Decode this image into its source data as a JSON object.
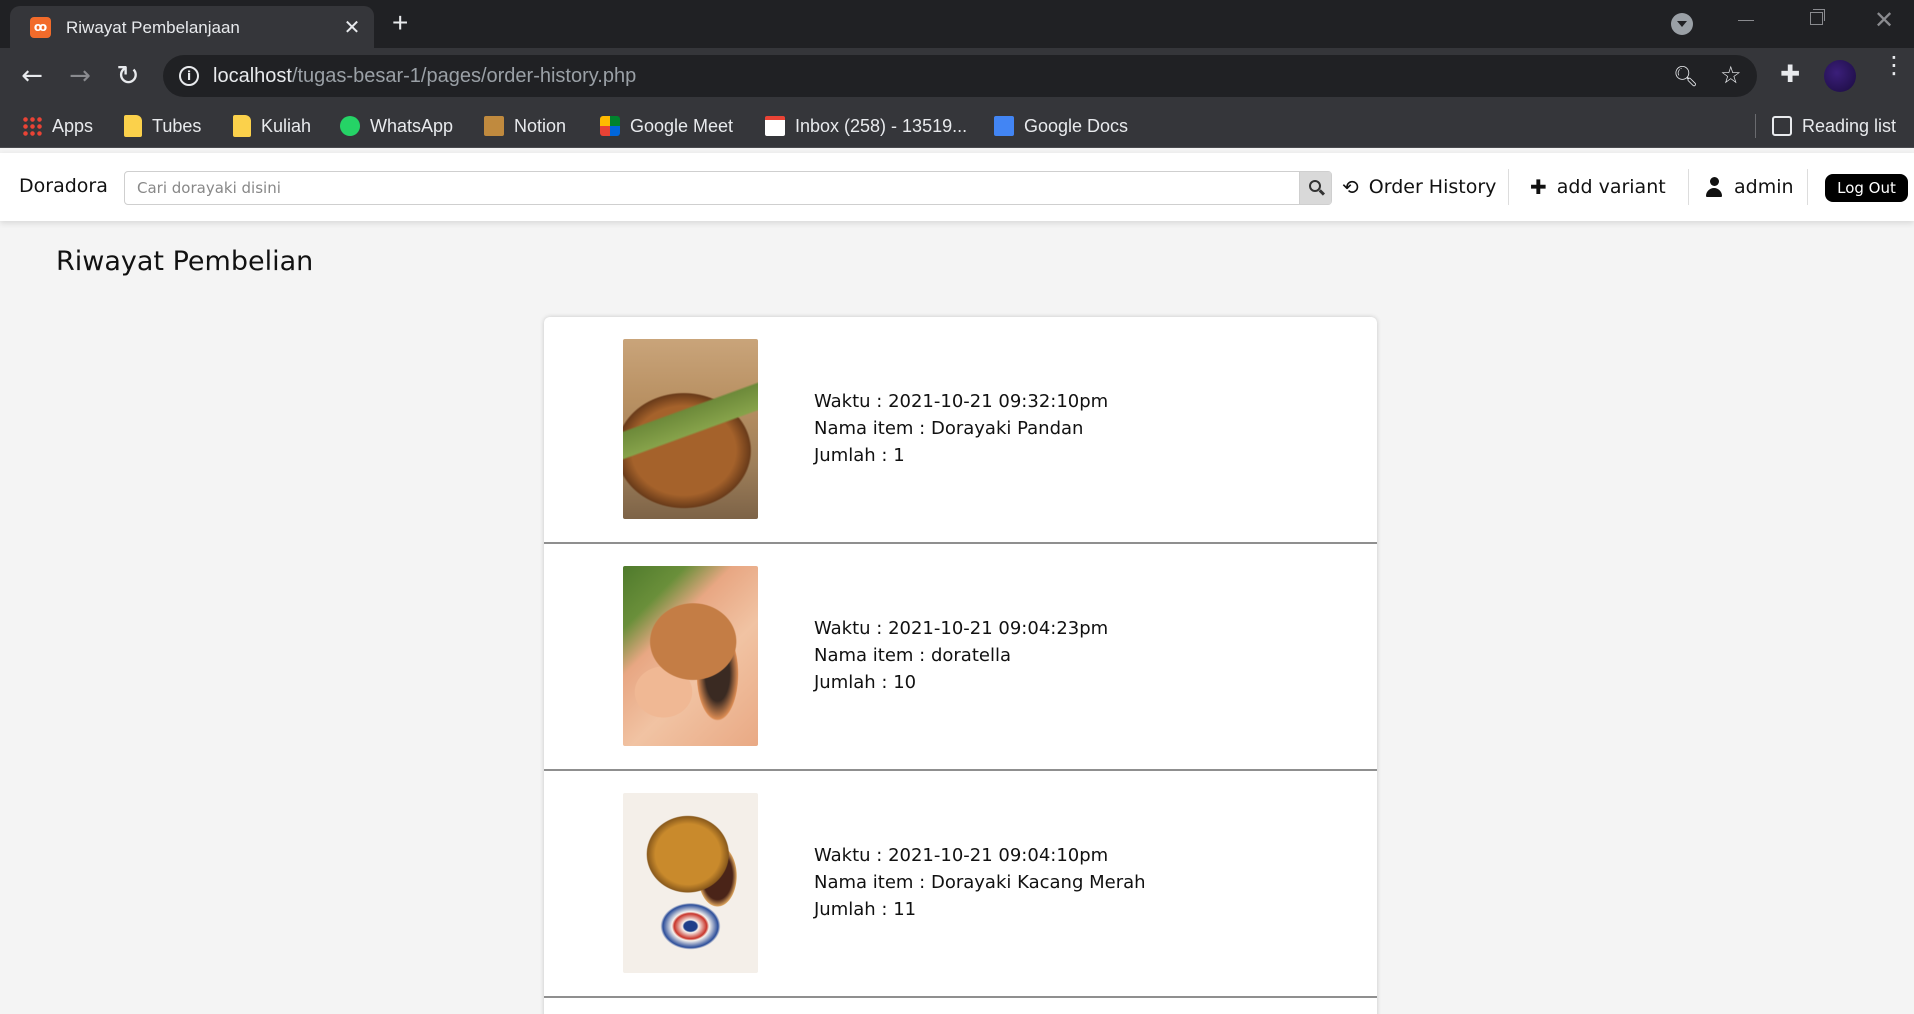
{
  "browser": {
    "tab_title": "Riwayat Pembelanjaan",
    "url_host": "localhost",
    "url_path": "/tugas-besar-1/pages/order-history.php",
    "bookmarks": [
      {
        "label": "Apps",
        "icon": "apps-grid-icon"
      },
      {
        "label": "Tubes",
        "icon": "folder-icon"
      },
      {
        "label": "Kuliah",
        "icon": "folder-icon"
      },
      {
        "label": "WhatsApp",
        "icon": "whatsapp-icon"
      },
      {
        "label": "Notion",
        "icon": "notion-icon"
      },
      {
        "label": "Google Meet",
        "icon": "google-meet-icon"
      },
      {
        "label": "Inbox (258) - 13519...",
        "icon": "gmail-icon"
      },
      {
        "label": "Google Docs",
        "icon": "google-docs-icon"
      }
    ],
    "reading_list": "Reading list"
  },
  "navbar": {
    "brand": "Doradora",
    "search_placeholder": "Cari dorayaki disini",
    "order_history": "Order History",
    "add_variant": "add variant",
    "user": "admin",
    "logout": "Log Out"
  },
  "page": {
    "title": "Riwayat Pembelian",
    "orders": [
      {
        "waktu": "Waktu : 2021-10-21 09:32:10pm",
        "nama": "Nama item : Dorayaki Pandan",
        "jumlah": "Jumlah : 1"
      },
      {
        "waktu": "Waktu : 2021-10-21 09:04:23pm",
        "nama": "Nama item : doratella",
        "jumlah": "Jumlah : 10"
      },
      {
        "waktu": "Waktu : 2021-10-21 09:04:10pm",
        "nama": "Nama item : Dorayaki Kacang Merah",
        "jumlah": "Jumlah : 11"
      }
    ]
  },
  "colors": {
    "chrome_dark": "#202124",
    "chrome_toolbar": "#35363a",
    "page_bg": "#f4f4f4",
    "logout_bg": "#000000"
  }
}
